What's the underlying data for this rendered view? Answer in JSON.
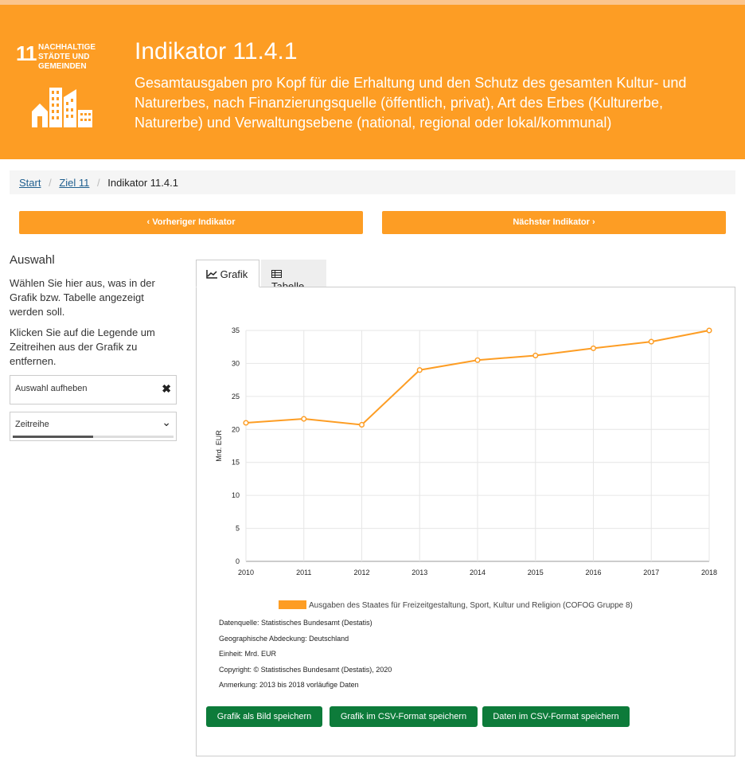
{
  "header": {
    "sdg_number": "11",
    "sdg_text_lines": [
      "NACHHALTIGE",
      "STÄDTE UND",
      "GEMEINDEN"
    ],
    "title": "Indikator 11.4.1",
    "description": "Gesamtausgaben pro Kopf für die Erhaltung und den Schutz des gesamten Kultur- und Naturerbes, nach Finanzierungsquelle (öffentlich, privat), Art des Erbes (Kulturerbe, Naturerbe) und Verwaltungsebene (national, regional oder lokal/kommunal)",
    "color": "#fd9d24"
  },
  "breadcrumb": {
    "start": "Start",
    "goal": "Ziel 11",
    "current": "Indikator 11.4.1"
  },
  "nav": {
    "prev_label": "Vorheriger Indikator",
    "next_label": "Nächster Indikator"
  },
  "sidebar": {
    "title": "Auswahl",
    "help1": "Wählen Sie hier aus, was in der Grafik bzw. Tabelle angezeigt werden soll.",
    "help2": "Klicken Sie auf die Legende um Zeitreihen aus der Grafik zu entfernen.",
    "clear_label": "Auswahl aufheben",
    "series_label": "Zeitreihe",
    "series_progress": 0.5
  },
  "tabs": {
    "chart_label": "Grafik",
    "table_label": "Tabelle"
  },
  "chart_data": {
    "type": "line",
    "x": [
      "2010",
      "2011",
      "2012",
      "2013",
      "2014",
      "2015",
      "2016",
      "2017",
      "2018"
    ],
    "series": [
      {
        "name": "Ausgaben des Staates für Freizeitgestaltung, Sport, Kultur und Religion (COFOG Gruppe 8)",
        "values": [
          21.0,
          21.6,
          20.7,
          29.0,
          30.5,
          31.2,
          32.3,
          33.3,
          35.0
        ],
        "color": "#fd9d24"
      }
    ],
    "ylabel": "Mrd. EUR",
    "ylim": [
      0,
      35
    ],
    "yticks": [
      0,
      5,
      10,
      15,
      20,
      25,
      30,
      35
    ],
    "grid": true,
    "legend": "bottom"
  },
  "meta": {
    "source": "Datenquelle: Statistisches Bundesamt (Destatis)",
    "coverage": "Geographische Abdeckung: Deutschland",
    "unit": "Einheit: Mrd. EUR",
    "copyright": "Copyright: © Statistisches Bundesamt (Destatis), 2020",
    "note": "Anmerkung: 2013 bis 2018 vorläufige Daten"
  },
  "downloads": {
    "image_label": "Grafik als Bild speichern",
    "chart_csv_label": "Grafik im CSV-Format speichern",
    "data_csv_label": "Daten im CSV-Format speichern",
    "color": "#0d7b3a"
  }
}
